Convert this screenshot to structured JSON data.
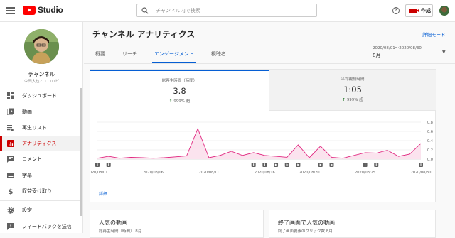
{
  "header": {
    "logo_text": "Studio",
    "search_placeholder": "チャンネル内で検索",
    "help_symbol": "?",
    "create_label": "作成"
  },
  "sidebar": {
    "channel_name": "チャンネル",
    "channel_sub": "今田大也とエロロビ",
    "items": [
      {
        "label": "ダッシュボード",
        "icon": "dashboard-icon"
      },
      {
        "label": "動画",
        "icon": "video-icon"
      },
      {
        "label": "再生リスト",
        "icon": "playlist-icon"
      },
      {
        "label": "アナリティクス",
        "icon": "analytics-icon",
        "active": true
      },
      {
        "label": "コメント",
        "icon": "comment-icon"
      },
      {
        "label": "字幕",
        "icon": "subtitles-icon"
      },
      {
        "label": "収益受け取り",
        "icon": "dollar-icon"
      },
      {
        "label": "設定",
        "icon": "gear-icon"
      },
      {
        "label": "フィードバックを送信",
        "icon": "feedback-icon"
      }
    ]
  },
  "main": {
    "title": "チャンネル アナリティクス",
    "detail_mode": "詳細モード",
    "tabs": [
      "概要",
      "リーチ",
      "エンゲージメント",
      "視聴者"
    ],
    "active_tab": 2,
    "date_range": "2020/08/01～2020/08/30",
    "date_month": "8月",
    "metrics": [
      {
        "label": "総再生時間（時間）",
        "value": "3.8",
        "change": "999% 超"
      },
      {
        "label": "平均視聴時間",
        "value": "1:05",
        "change": "999% 超"
      }
    ],
    "detail_link": "詳細",
    "bottom_cards": [
      {
        "title": "人気の動画",
        "sub": "総再生時間（時間）  8月"
      },
      {
        "title": "終了画面で人気の動画",
        "sub": "終了画面要素のクリック数  8月"
      }
    ]
  },
  "colors": {
    "accent": "#065fd4",
    "brand_red": "#ff0000",
    "active_red": "#cc0000",
    "line": "#e0267f",
    "area": "#fbe3ee",
    "up_arrow": "#2e7d32"
  },
  "chart_data": {
    "type": "line",
    "x": [
      "2020/08/01",
      "2020/08/02",
      "2020/08/03",
      "2020/08/04",
      "2020/08/05",
      "2020/08/06",
      "2020/08/07",
      "2020/08/08",
      "2020/08/09",
      "2020/08/10",
      "2020/08/11",
      "2020/08/12",
      "2020/08/13",
      "2020/08/14",
      "2020/08/15",
      "2020/08/16",
      "2020/08/17",
      "2020/08/18",
      "2020/08/19",
      "2020/08/20",
      "2020/08/21",
      "2020/08/22",
      "2020/08/23",
      "2020/08/24",
      "2020/08/25",
      "2020/08/26",
      "2020/08/27",
      "2020/08/28",
      "2020/08/29",
      "2020/08/30"
    ],
    "series": [
      {
        "values": [
          0.02,
          0.06,
          0.02,
          0.04,
          0.03,
          0.02,
          0.03,
          0.05,
          0.07,
          0.66,
          0.03,
          0.08,
          0.17,
          0.08,
          0.14,
          0.08,
          0.06,
          0.04,
          0.31,
          0.03,
          0.28,
          0.04,
          0.02,
          0.08,
          0.14,
          0.13,
          0.19,
          0.06,
          0.11,
          0.34
        ]
      }
    ],
    "ylim": [
      0,
      0.8
    ],
    "yticks": [
      "0.8",
      "0.6",
      "0.4",
      "0.2",
      "0.0"
    ],
    "xtick_labels": [
      "2020/08/01",
      "2020/08/06",
      "2020/08/11",
      "2020/08/16",
      "2020/08/20",
      "2020/08/25",
      "2020/08/30"
    ],
    "xtick_days": [
      1,
      6,
      11,
      16,
      20,
      25,
      30
    ],
    "markers": [
      {
        "day": 1,
        "icon": "upload-marker-icon"
      },
      {
        "day": 2,
        "icon": "upload-marker-icon"
      },
      {
        "day": 15,
        "icon": "upload-marker-icon"
      },
      {
        "day": 16,
        "icon": "upload-marker-icon"
      },
      {
        "day": 17,
        "icon": "play-marker-icon"
      },
      {
        "day": 18,
        "icon": "play-marker-icon"
      },
      {
        "day": 19,
        "icon": "play-marker-icon"
      },
      {
        "day": 21,
        "icon": "play-marker-icon"
      },
      {
        "day": 22,
        "icon": "play-marker-icon"
      },
      {
        "day": 25,
        "icon": "upload-marker-icon"
      },
      {
        "day": 26,
        "icon": "upload-marker-icon"
      },
      {
        "day": 30,
        "icon": "upload-marker-icon"
      }
    ]
  }
}
